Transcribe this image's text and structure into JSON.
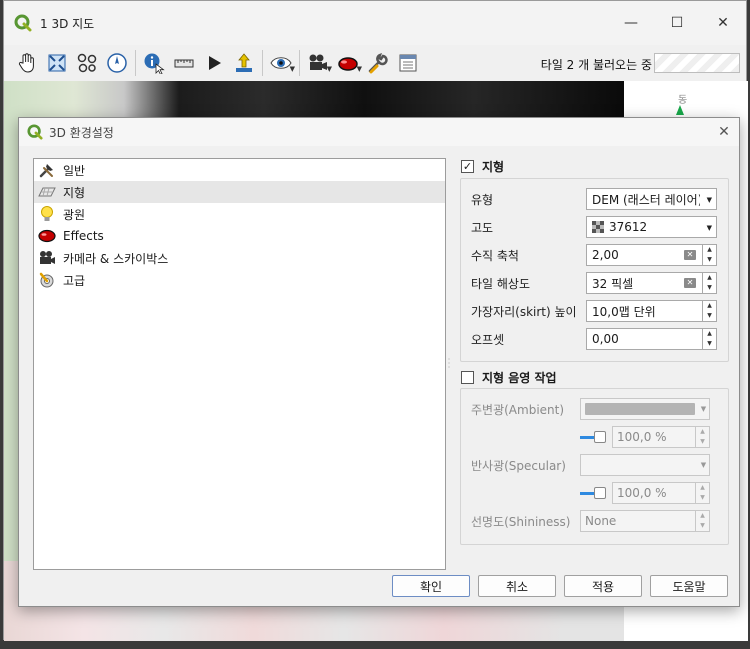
{
  "main_window": {
    "title": "1 3D 지도",
    "controls": {
      "minimize": "—",
      "maximize": "☐",
      "close": "✕"
    }
  },
  "toolbar": {
    "loading_label": "타일 2 개 불러오는 중",
    "buttons": [
      "pan-map",
      "zoom-full",
      "identify-3d",
      "camera-north",
      "identify",
      "measure",
      "animation-play",
      "export-3d",
      "view-menu",
      "camera-menu",
      "effects-menu",
      "configure",
      "map-theme"
    ]
  },
  "navigation": {
    "north_label": "동"
  },
  "dialog": {
    "title": "3D 환경설정",
    "close": "✕",
    "categories": [
      {
        "label": "일반",
        "icon": "hammer-icon"
      },
      {
        "label": "지형",
        "icon": "terrain-icon",
        "selected": true
      },
      {
        "label": "광원",
        "icon": "lightbulb-icon"
      },
      {
        "label": "Effects",
        "icon": "effects-icon"
      },
      {
        "label": "카메라 & 스카이박스",
        "icon": "camera-icon"
      },
      {
        "label": "고급",
        "icon": "advanced-icon"
      }
    ],
    "terrain": {
      "checked": true,
      "title": "지형",
      "type_label": "유형",
      "type_value": "DEM (래스터 레이어)",
      "elevation_label": "고도",
      "elevation_value": "37612",
      "vscale_label": "수직 축척",
      "vscale_value": "2,00",
      "tile_res_label": "타일 해상도",
      "tile_res_value": "32 픽셀",
      "skirt_label": "가장자리(skirt) 높이",
      "skirt_value": "10,0맵 단위",
      "offset_label": "오프셋",
      "offset_value": "0,00"
    },
    "shading": {
      "checked": false,
      "title": "지형 음영 작업",
      "ambient_label": "주변광(Ambient)",
      "ambient_color": "#b4b4b4",
      "ambient_pct": "100,0 %",
      "specular_label": "반사광(Specular)",
      "specular_color": "#f4f4f4",
      "specular_pct": "100,0 %",
      "shininess_label": "선명도(Shininess)",
      "shininess_value": "None"
    },
    "buttons": {
      "ok": "확인",
      "cancel": "취소",
      "apply": "적용",
      "help": "도움말"
    }
  }
}
